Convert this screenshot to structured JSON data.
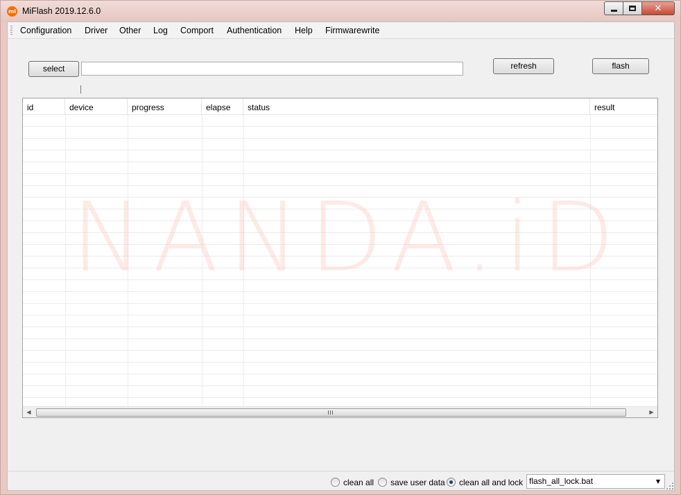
{
  "window": {
    "title": "MiFlash 2019.12.6.0",
    "app_icon_text": "mi",
    "caption": {
      "close_glyph": "✕"
    }
  },
  "menu": [
    "Configuration",
    "Driver",
    "Other",
    "Log",
    "Comport",
    "Authentication",
    "Help",
    "Firmwarewrite"
  ],
  "toolbar": {
    "select_label": "select",
    "path_value": "",
    "refresh_label": "refresh",
    "flash_label": "flash"
  },
  "table": {
    "columns": [
      "id",
      "device",
      "progress",
      "elapse",
      "status",
      "result"
    ],
    "rows": []
  },
  "watermark": "NANDA.iD",
  "scrollbar": {
    "left_arrow": "◀",
    "right_arrow": "▶"
  },
  "options": {
    "radios": [
      {
        "label": "clean all",
        "checked": false
      },
      {
        "label": "save user data",
        "checked": false
      },
      {
        "label": "clean all and lock",
        "checked": true
      }
    ],
    "script_selected": "flash_all_lock.bat",
    "dropdown_arrow": "▼"
  },
  "colors": {
    "brand": "#ff6a00",
    "close_button": "#c84a33",
    "window_frame": "#e8c9c4",
    "radio_dot": "#1d3d6f"
  }
}
